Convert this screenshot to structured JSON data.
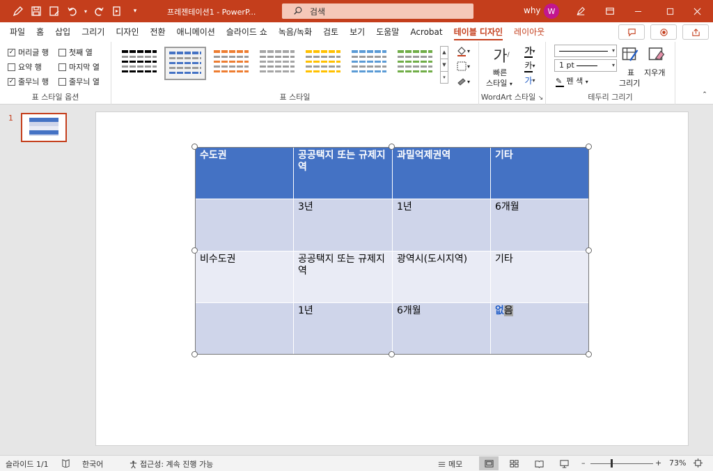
{
  "window": {
    "title": "프레젠테이션1  -  PowerP...",
    "search_placeholder": "검색",
    "user_name": "why",
    "avatar_initial": "W"
  },
  "tabs": [
    "파일",
    "홈",
    "삽입",
    "그리기",
    "디자인",
    "전환",
    "애니메이션",
    "슬라이드 쇼",
    "녹음/녹화",
    "검토",
    "보기",
    "도움말",
    "Acrobat",
    "테이블 디자인",
    "레이아웃"
  ],
  "active_tab": "테이블 디자인",
  "ribbon": {
    "style_options": {
      "header_row": "머리글 행",
      "total_row": "요약 행",
      "banded_rows": "줄무늬 행",
      "first_column": "첫째 열",
      "last_column": "마지막 열",
      "banded_columns": "줄무늬 열",
      "group_label": "표 스타일 옵션",
      "checked": [
        "머리글 행",
        "줄무늬 행"
      ]
    },
    "table_styles": {
      "group_label": "표 스타일",
      "swatch_colors": [
        "#000000",
        "#4472c4",
        "#ed7d31",
        "#a5a5a5",
        "#ffc000",
        "#5b9bd5",
        "#70ad47"
      ],
      "selected_index": 1
    },
    "wordart": {
      "quick_styles_label1": "빠른",
      "quick_styles_label2": "스타일",
      "group_label": "WordArt 스타일"
    },
    "borders": {
      "pen_weight": "1 pt",
      "pen_color_label": "펜 색",
      "draw_table_label1": "표",
      "draw_table_label2": "그리기",
      "eraser_label": "지우개",
      "group_label": "테두리 그리기"
    }
  },
  "thumbnail": {
    "slide_number": "1"
  },
  "table": {
    "rows": [
      [
        "수도권",
        "공공택지 또는 규제지역",
        "과밀억제권역",
        "기타"
      ],
      [
        "",
        "3년",
        "1년",
        "6개월"
      ],
      [
        "비수도권",
        "공공택지 또는 규제지역",
        "광역시(도시지역)",
        "기타"
      ],
      [
        "",
        "1년",
        "6개월",
        ""
      ]
    ],
    "editing_cell": {
      "composed": "없",
      "selected": "음"
    }
  },
  "status": {
    "slide_count": "슬라이드 1/1",
    "language": "한국어",
    "accessibility": "접근성: 계속 진행 가능",
    "notes": "메모",
    "zoom": "73%"
  }
}
